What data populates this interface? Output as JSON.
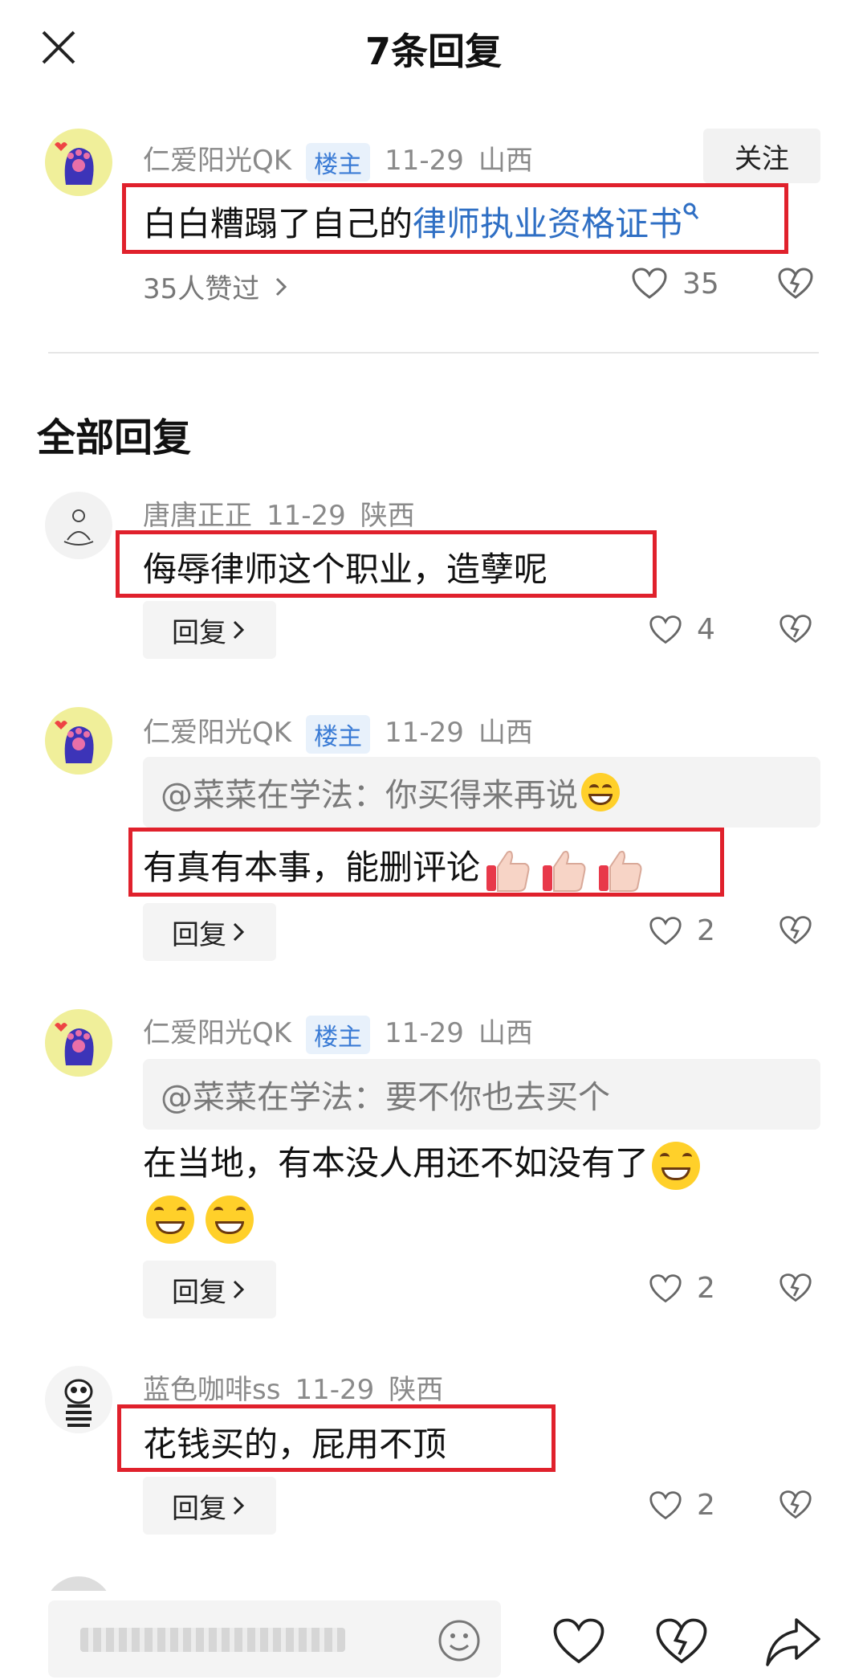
{
  "header": {
    "title": "7条回复"
  },
  "main_comment": {
    "user": "仁爱阳光QK",
    "badge": "楼主",
    "date": "11-29",
    "location": "山西",
    "follow_label": "关注",
    "text_plain": "白白糟蹋了自己的",
    "text_link": "律师执业资格证书",
    "likers": "35人赞过",
    "like_count": "35"
  },
  "section_title": "全部回复",
  "replies": [
    {
      "user": "唐唐正正",
      "date": "11-29",
      "location": "陕西",
      "text": "侮辱律师这个职业，造孽呢",
      "reply_label": "回复",
      "likes": "4"
    },
    {
      "user": "仁爱阳光QK",
      "badge": "楼主",
      "date": "11-29",
      "location": "山西",
      "quote": "@菜菜在学法：你买得来再说",
      "text": "有真有本事，能删评论",
      "reply_label": "回复",
      "likes": "2"
    },
    {
      "user": "仁爱阳光QK",
      "badge": "楼主",
      "date": "11-29",
      "location": "山西",
      "quote": "@菜菜在学法：要不你也去买个",
      "text": "在当地，有本没人用还不如没有了",
      "reply_label": "回复",
      "likes": "2"
    },
    {
      "user": "蓝色咖啡ss",
      "date": "11-29",
      "location": "陕西",
      "text": "花钱买的，屁用不顶",
      "reply_label": "回复",
      "likes": "2"
    }
  ],
  "colors": {
    "highlight_box": "#e0212c",
    "link": "#2f6fc4",
    "badge_bg": "#e8f1fb",
    "badge_text": "#3a7bd5"
  }
}
